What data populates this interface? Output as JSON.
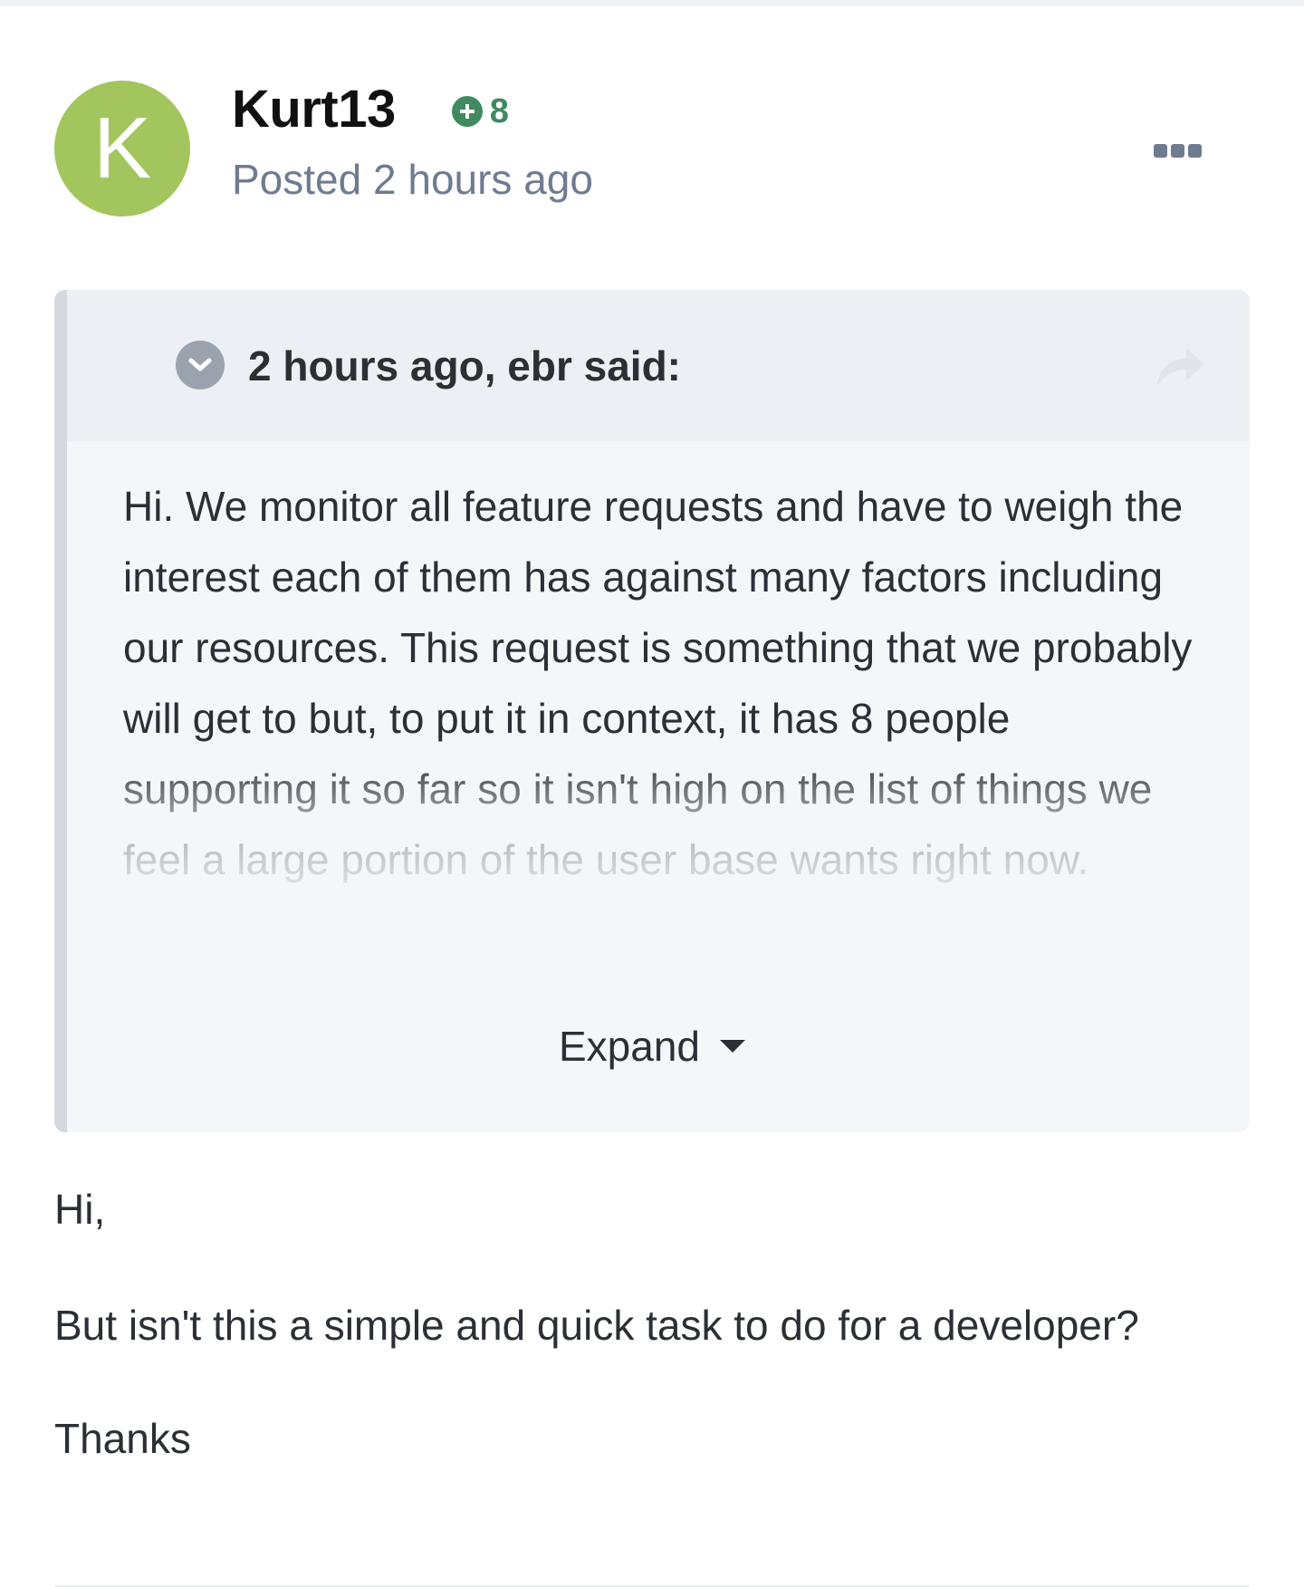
{
  "post": {
    "avatar_letter": "K",
    "author": "Kurt13",
    "reputation": "8",
    "posted": "Posted 2 hours ago",
    "quote": {
      "citation": "2 hours ago, ebr said:",
      "text": "Hi.  We monitor all feature requests and have to weigh the interest each of them has against many factors including our resources.  This request is something that we probably will get to but, to put it in context, it has 8 people supporting it so far so it isn't high on the list of things we feel a large portion of the user base wants right now.",
      "expand_label": "Expand"
    },
    "reply": {
      "line1": "Hi,",
      "line2": "But isn't this a simple and quick task to do for a developer?",
      "line3": "Thanks"
    }
  },
  "colors": {
    "avatar": "#a2c65d",
    "reputation": "#3f8a5f",
    "muted": "#6f7b90",
    "text": "#2b2f36",
    "quote_bg": "#f4f7fa",
    "quote_header_bg": "#eceff3",
    "quote_bar": "#d5d9df"
  },
  "icons": {
    "reputation": "plus-circle-icon",
    "menu": "more-options-icon",
    "quote_toggle": "chevron-down-icon",
    "share": "share-icon",
    "expand": "caret-down-icon"
  }
}
